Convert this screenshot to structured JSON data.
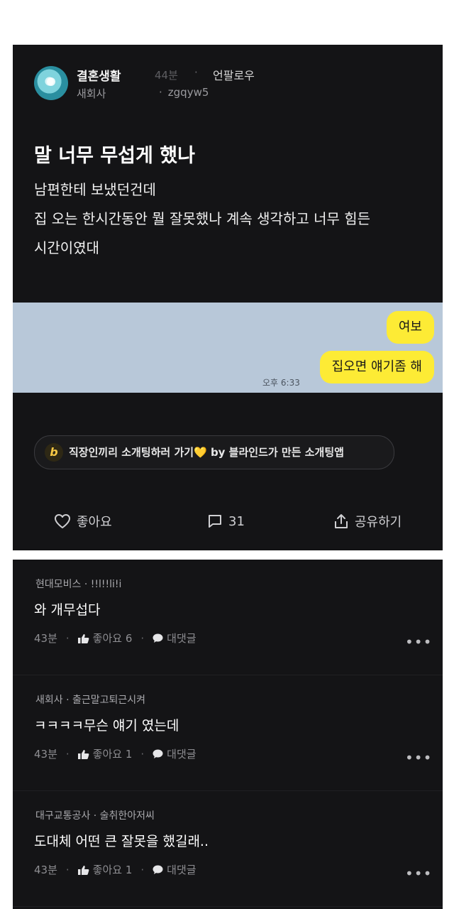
{
  "post": {
    "author": {
      "name": "결혼생활",
      "time": "44분",
      "follow_label": "언팔로우",
      "company": "새회사",
      "user_id": "zgqyw5"
    },
    "title": "말 너무 무섭게 했나",
    "body": [
      "남편한테 보냈던건데",
      "집 오는 한시간동안 뭘 잘못했나 계속 생각하고 너무 힘든",
      "시간이였대"
    ],
    "chat_image": {
      "messages": [
        "여보",
        "집오면 얘기좀 해"
      ],
      "time": "오후 6:33"
    },
    "ad": {
      "icon_letter": "b",
      "text": "직장인끼리 소개팅하러 가기💛 by 블라인드가 만든 소개팅앱"
    },
    "actions": {
      "like_label": "좋아요",
      "comment_count": "31",
      "share_label": "공유하기"
    }
  },
  "comments": [
    {
      "company": "현대모비스",
      "user": "!!l!!li!i",
      "text": "와 개무섭다",
      "time": "43분",
      "like_label": "좋아요 6",
      "reply_label": "대댓글"
    },
    {
      "company": "새회사",
      "user": "출근말고퇴근시켜",
      "text": "ㅋㅋㅋㅋ무슨 얘기 였는데",
      "time": "43분",
      "like_label": "좋아요 1",
      "reply_label": "대댓글"
    },
    {
      "company": "대구교통공사",
      "user": "술취한아저씨",
      "text": "도대체 어떤 큰 잘못을 했길래..",
      "time": "43분",
      "like_label": "좋아요 1",
      "reply_label": "대댓글"
    }
  ],
  "icons": {
    "like": "heart-outline-icon",
    "comment": "speech-bubble-icon",
    "share": "share-upload-icon",
    "comment_like": "thumbs-up-icon",
    "reply": "chat-bubble-icon",
    "more": "more-dots-icon"
  },
  "colors": {
    "background": "#141416",
    "chat_bubble": "#fdeb35",
    "chat_background": "#b8c8d9"
  }
}
